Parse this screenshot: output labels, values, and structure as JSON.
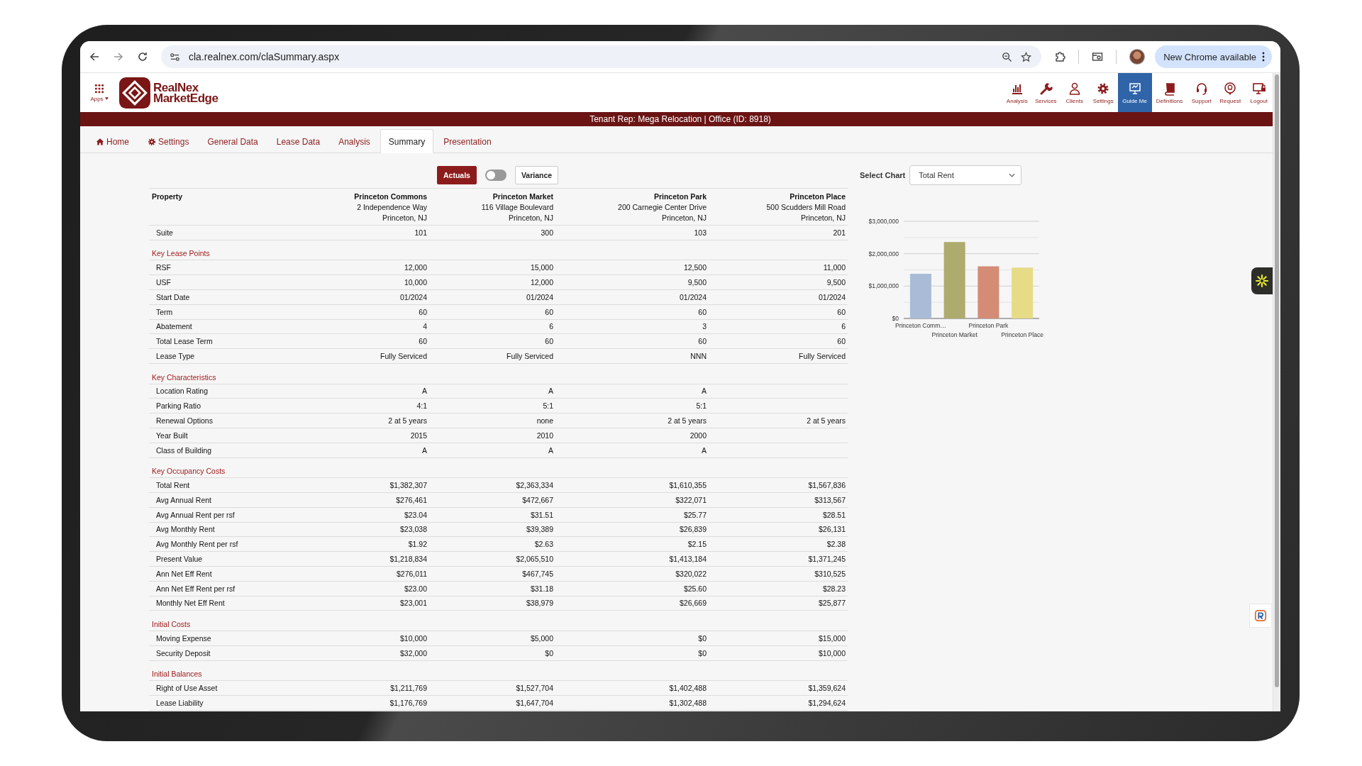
{
  "browser": {
    "url": "cla.realnex.com/claSummary.aspx",
    "update_button": "New Chrome available"
  },
  "app": {
    "apps_label": "Apps",
    "logo": [
      "RealNex",
      "MarketEdge"
    ],
    "nav": [
      {
        "label": "Analysis",
        "selected": false
      },
      {
        "label": "Services",
        "selected": false
      },
      {
        "label": "Clients",
        "selected": false
      },
      {
        "label": "Settings",
        "selected": false
      },
      {
        "label": "Guide Me",
        "selected": true
      },
      {
        "label": "Definitions",
        "selected": false
      },
      {
        "label": "Support",
        "selected": false
      },
      {
        "label": "Request",
        "selected": false
      },
      {
        "label": "Logout",
        "selected": false
      }
    ]
  },
  "banner": "Tenant Rep: Mega Relocation | Office (ID: 8918)",
  "tabs": [
    {
      "label": "Home",
      "selected": false
    },
    {
      "label": "Settings",
      "selected": false
    },
    {
      "label": "General Data",
      "selected": false
    },
    {
      "label": "Lease Data",
      "selected": false
    },
    {
      "label": "Analysis",
      "selected": false
    },
    {
      "label": "Summary",
      "selected": true
    },
    {
      "label": "Presentation",
      "selected": false
    }
  ],
  "view_toggle": {
    "options": [
      {
        "label": "Actuals",
        "selected": true
      },
      {
        "label": "Variance",
        "selected": false
      }
    ],
    "on": false
  },
  "table": {
    "header_label": "Property",
    "properties": [
      {
        "name": "Princeton Commons",
        "address": "2 Independence Way",
        "city": "Princeton, NJ"
      },
      {
        "name": "Princeton Market",
        "address": "116 Village Boulevard",
        "city": "Princeton, NJ"
      },
      {
        "name": "Princeton Park",
        "address": "200 Carnegie Center Drive",
        "city": "Princeton, NJ"
      },
      {
        "name": "Princeton Place",
        "address": "500 Scudders Mill Road",
        "city": "Princeton, NJ"
      }
    ],
    "suite": {
      "label": "Suite",
      "values": [
        "101",
        "300",
        "103",
        "201"
      ]
    },
    "sections": [
      {
        "title": "Key Lease Points",
        "rows": [
          {
            "label": "RSF",
            "values": [
              "12,000",
              "15,000",
              "12,500",
              "11,000"
            ]
          },
          {
            "label": "USF",
            "values": [
              "10,000",
              "12,000",
              "9,500",
              "9,500"
            ]
          },
          {
            "label": "Start Date",
            "values": [
              "01/2024",
              "01/2024",
              "01/2024",
              "01/2024"
            ]
          },
          {
            "label": "Term",
            "values": [
              "60",
              "60",
              "60",
              "60"
            ]
          },
          {
            "label": "Abatement",
            "values": [
              "4",
              "6",
              "3",
              "6"
            ]
          },
          {
            "label": "Total Lease Term",
            "values": [
              "60",
              "60",
              "60",
              "60"
            ]
          },
          {
            "label": "Lease Type",
            "values": [
              "Fully Serviced",
              "Fully Serviced",
              "NNN",
              "Fully Serviced"
            ]
          }
        ]
      },
      {
        "title": "Key Characteristics",
        "rows": [
          {
            "label": "Location Rating",
            "values": [
              "A",
              "A",
              "A"
            ]
          },
          {
            "label": "Parking Ratio",
            "values": [
              "4:1",
              "5:1",
              "5:1"
            ]
          },
          {
            "label": "Renewal Options",
            "values": [
              "2 at 5 years",
              "none",
              "2 at 5 years",
              "2 at 5 years"
            ]
          },
          {
            "label": "Year Built",
            "values": [
              "2015",
              "2010",
              "2000"
            ]
          },
          {
            "label": "Class of Building",
            "values": [
              "A",
              "A",
              "A"
            ]
          }
        ]
      },
      {
        "title": "Key Occupancy Costs",
        "rows": [
          {
            "label": "Total Rent",
            "values": [
              "$1,382,307",
              "$2,363,334",
              "$1,610,355",
              "$1,567,836"
            ]
          },
          {
            "label": "Avg Annual Rent",
            "values": [
              "$276,461",
              "$472,667",
              "$322,071",
              "$313,567"
            ]
          },
          {
            "label": "Avg Annual Rent per rsf",
            "values": [
              "$23.04",
              "$31.51",
              "$25.77",
              "$28.51"
            ]
          },
          {
            "label": "Avg Monthly Rent",
            "values": [
              "$23,038",
              "$39,389",
              "$26,839",
              "$26,131"
            ]
          },
          {
            "label": "Avg Monthly Rent per rsf",
            "values": [
              "$1.92",
              "$2.63",
              "$2.15",
              "$2.38"
            ]
          },
          {
            "label": "Present Value",
            "values": [
              "$1,218,834",
              "$2,065,510",
              "$1,413,184",
              "$1,371,245"
            ]
          },
          {
            "label": "Ann Net Eff Rent",
            "values": [
              "$276,011",
              "$467,745",
              "$320,022",
              "$310,525"
            ]
          },
          {
            "label": "Ann Net Eff Rent per rsf",
            "values": [
              "$23.00",
              "$31.18",
              "$25.60",
              "$28.23"
            ]
          },
          {
            "label": "Monthly Net Eff Rent",
            "values": [
              "$23,001",
              "$38,979",
              "$26,669",
              "$25,877"
            ]
          }
        ]
      },
      {
        "title": "Initial Costs",
        "rows": [
          {
            "label": "Moving Expense",
            "values": [
              "$10,000",
              "$5,000",
              "$0",
              "$15,000"
            ]
          },
          {
            "label": "Security Deposit",
            "values": [
              "$32,000",
              "$0",
              "$0",
              "$10,000"
            ]
          }
        ]
      },
      {
        "title": "Initial Balances",
        "rows": [
          {
            "label": "Right of Use Asset",
            "values": [
              "$1,211,769",
              "$1,527,704",
              "$1,402,488",
              "$1,359,624"
            ]
          },
          {
            "label": "Lease Liability",
            "values": [
              "$1,176,769",
              "$1,647,704",
              "$1,302,488",
              "$1,294,624"
            ]
          }
        ]
      }
    ]
  },
  "chart_panel": {
    "label": "Select Chart",
    "value": "Total Rent",
    "chart_data": {
      "type": "bar",
      "categories": [
        "Princeton Comm…",
        "Princeton Market",
        "Princeton Park",
        "Princeton Place"
      ],
      "values": [
        1380000,
        2360000,
        1610000,
        1570000
      ],
      "colors": [
        "#a9bbd6",
        "#aeab6e",
        "#d48c76",
        "#e6dc88"
      ],
      "ylim": [
        0,
        3000000
      ],
      "yticks": [
        {
          "value": 0,
          "label": "$0"
        },
        {
          "value": 1000000,
          "label": "$1,000,000"
        },
        {
          "value": 2000000,
          "label": "$2,000,000"
        },
        {
          "value": 3000000,
          "label": "$3,000,000"
        }
      ]
    }
  }
}
